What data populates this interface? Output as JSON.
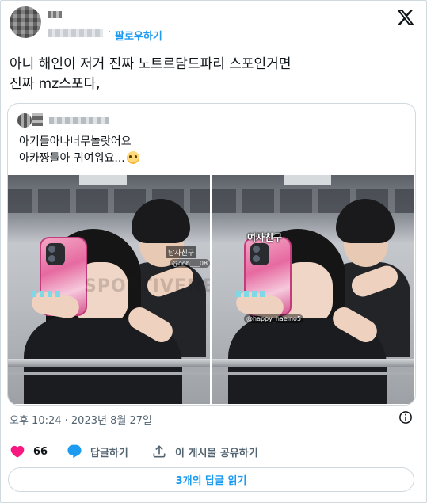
{
  "header": {
    "follow_label": "팔로우하기",
    "separator": "·",
    "logo_icon": "x-logo-icon"
  },
  "tweet": {
    "lines": [
      "아니 해인이 저거 진짜 노트르담드파리 스포인거면",
      "진짜 mz스포다,"
    ]
  },
  "quote": {
    "lines": [
      "아기들아나너무놀랏어요",
      "아카쨩들아 귀여워요..."
    ],
    "emoji_icon": "pleading-face-emoji-icon"
  },
  "photos": {
    "left": {
      "label_top": "남자친구",
      "label_handle": "@ooh___08",
      "watermark": "SPORTIVENEWS"
    },
    "right": {
      "label_big": "여자친구",
      "label_handle": "@happy_haeino5"
    }
  },
  "meta": {
    "timestamp": "오후 10:24 · 2023년 8월 27일"
  },
  "actions": {
    "like_count": "66",
    "reply_label": "답글하기",
    "share_label": "이 게시물 공유하기"
  },
  "read_replies_label": "3개의 답글 읽기",
  "colors": {
    "accent": "#1d9bf0",
    "like": "#f91880",
    "text": "#0f1419",
    "secondary": "#536471",
    "border": "#cfd9de"
  }
}
